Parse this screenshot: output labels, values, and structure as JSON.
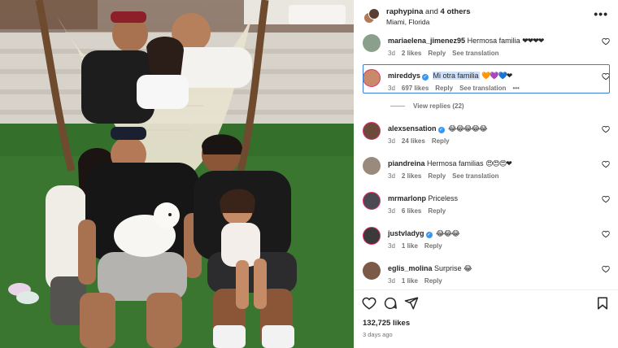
{
  "post": {
    "header": {
      "username": "raphypina",
      "connector": " and ",
      "others": "4 others",
      "location": "Miami, Florida"
    },
    "comments": [
      {
        "username": "mariaelena_jimenez95",
        "text": "Hermosa familia",
        "emoji": "❤❤❤❤",
        "verified": false,
        "time": "3d",
        "likes": "2 likes",
        "reply": "Reply",
        "translation": "See translation",
        "avatar_color": "#8aa08c"
      },
      {
        "username": "mireddys",
        "text": "Mi otra familia",
        "emoji": "🧡💜💙❤",
        "verified": true,
        "time": "3d",
        "likes": "697 likes",
        "reply": "Reply",
        "translation": "See translation",
        "more": "•••",
        "avatar_color": "#c98a6a"
      },
      {
        "username": "alexsensation",
        "text": "",
        "emoji": "😂😂😂😂😂",
        "verified": true,
        "time": "3d",
        "likes": "24 likes",
        "reply": "Reply",
        "translation": "",
        "avatar_color": "#6b4a3c"
      },
      {
        "username": "piandreina",
        "text": "Hermosa familias",
        "emoji": "😍😍😍❤",
        "verified": false,
        "time": "3d",
        "likes": "2 likes",
        "reply": "Reply",
        "translation": "See translation",
        "avatar_color": "#9a8a7c"
      },
      {
        "username": "mrmarlonp",
        "text": "Priceless",
        "emoji": "",
        "verified": false,
        "time": "3d",
        "likes": "6 likes",
        "reply": "Reply",
        "translation": "",
        "avatar_color": "#4a4a52"
      },
      {
        "username": "justvladyg",
        "text": "",
        "emoji": "😂😂😂",
        "verified": true,
        "time": "3d",
        "likes": "1 like",
        "reply": "Reply",
        "translation": "",
        "avatar_color": "#3a3a3a"
      },
      {
        "username": "eglis_molina",
        "text": "Surprise",
        "emoji": "😂",
        "verified": false,
        "time": "3d",
        "likes": "1 like",
        "reply": "Reply",
        "translation": "",
        "avatar_color": "#7b5a48"
      }
    ],
    "view_replies": "View replies (22)",
    "likes_count": "132,725 likes",
    "posted_ago": "3 days ago"
  },
  "icons": {
    "more": "more-horizontal-icon",
    "heart": "heart-outline-icon",
    "comment": "comment-icon",
    "share": "share-icon",
    "bookmark": "bookmark-icon"
  },
  "colors": {
    "highlight_border": "#3d7bd9",
    "selection": "#cfe0fb",
    "verified": "#3897f0",
    "meta_text": "#737373"
  }
}
